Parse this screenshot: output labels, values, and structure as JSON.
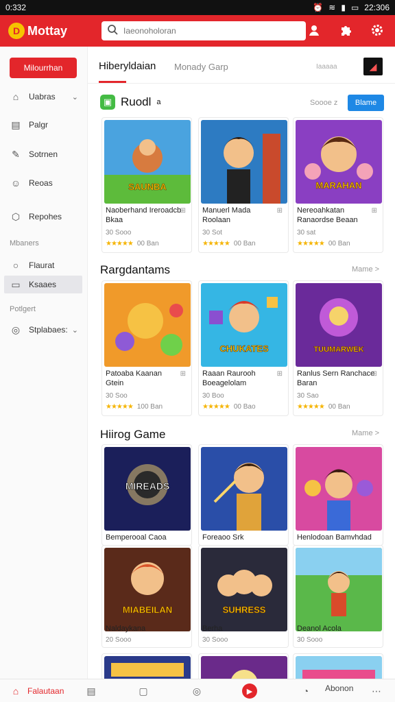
{
  "status_bar": {
    "time": "0:332",
    "right_time": "22:306"
  },
  "app": {
    "name": "Mottay"
  },
  "search": {
    "placeholder": "Iaeonoholoran"
  },
  "sidebar": {
    "primary_button": "Milourrhan",
    "items": [
      {
        "label": "Uabras",
        "icon": "home-icon",
        "chevron": true
      },
      {
        "label": "Palgr",
        "icon": "document-icon",
        "chevron": false
      },
      {
        "label": "Sotrnen",
        "icon": "edit-icon",
        "chevron": false
      },
      {
        "label": "Reoas",
        "icon": "user-icon",
        "chevron": false
      },
      {
        "label": "Repohes",
        "icon": "cube-icon",
        "chevron": false
      }
    ],
    "section1": "Mbaners",
    "items2": [
      {
        "label": "Flaurat",
        "icon": "circle-icon"
      },
      {
        "label": "Ksaaes",
        "icon": "folder-icon"
      }
    ],
    "section2": "Potlgert",
    "items3": [
      {
        "label": "Stplabaes:",
        "icon": "compass-icon"
      }
    ]
  },
  "tabs": {
    "active": "Hiberyldaian",
    "second": "Monady Garp",
    "small": "Iaaaaa"
  },
  "sections": [
    {
      "title": "Ruodl",
      "title_suffix": "a",
      "link": "Soooe z",
      "button": "Blame",
      "cards": [
        {
          "title": "Naoberhand Ireroadcb",
          "title2": "Bkaa",
          "sub": "30 Sooo",
          "rating": "00 Ban"
        },
        {
          "title": "Manuerl Mada",
          "title2": "Roolaan",
          "sub": "30 Sot",
          "rating": "00 Ban"
        },
        {
          "title": "Nereoahkatan",
          "title2": "Ranaordse Beaan",
          "sub": "30 sat",
          "rating": "00 Ban"
        }
      ]
    },
    {
      "title": "Rargdantams",
      "link": "Mame >",
      "cards": [
        {
          "title": "Patoaba Kaanan",
          "title2": "Gtein",
          "sub": "30 Soo",
          "rating": "100 Ban"
        },
        {
          "title": "Raaan Raurooh",
          "title2": "Boeagelolam",
          "sub": "30 Boo",
          "rating": "00 Bao"
        },
        {
          "title": "Ranlus Sern Ranchace",
          "title2": "Baran",
          "sub": "30 Sao",
          "rating": "00 Ban"
        }
      ]
    },
    {
      "title": "Hiirog Game",
      "link": "Mame >",
      "cards": [
        {
          "title": "Bemperooal Caoa"
        },
        {
          "title": "Foreaoo Srk"
        },
        {
          "title": "Henlodoan Bamvhdad"
        },
        {
          "title": "Naldaykana",
          "sub": "20 Sooo"
        },
        {
          "title": "Berha",
          "sub": "30 Sooo"
        },
        {
          "title": "Deanol Acola",
          "sub": "30 Sooo"
        }
      ]
    }
  ],
  "thumb_texts": [
    "SAUNBA",
    "",
    "MARAHAN",
    "",
    "CHUKATES",
    "TUUMARWEK",
    "MIREADS",
    "",
    "",
    "MIABEILAN",
    "SUHRESS",
    ""
  ],
  "bottom_nav": {
    "left_label": "Falautaan",
    "right_label": "Abonon"
  },
  "colors": {
    "accent": "#e3262b",
    "blue": "#1e88e5",
    "star": "#f5b400"
  }
}
